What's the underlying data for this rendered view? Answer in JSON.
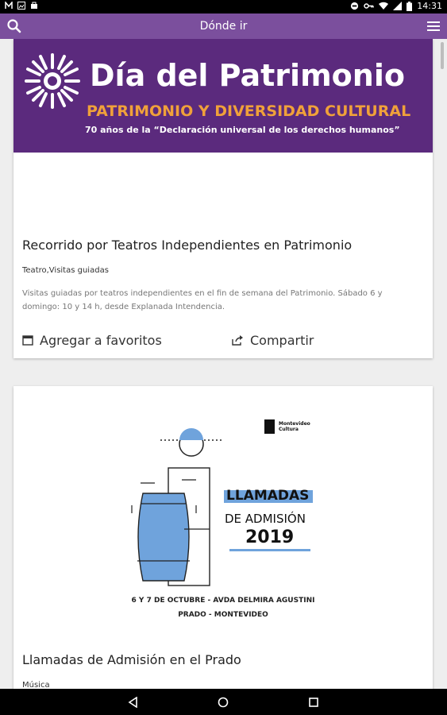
{
  "status": {
    "left_icons": [
      "m-icon",
      "image-icon",
      "bag-icon"
    ],
    "time": "14:31"
  },
  "appbar": {
    "title": "Dónde ir"
  },
  "cards": [
    {
      "banner": {
        "title": "Día del Patrimonio",
        "subtitle": "PATRIMONIO Y DIVERSIDAD CULTURAL",
        "caption": "70 años de la “Declaración universal de los derechos humanos”",
        "accent": "#5b2a7d",
        "orange": "#f0a13a"
      },
      "title": "Recorrido por Teatros Independientes en Patrimonio",
      "category": "Teatro,Visitas guiadas",
      "description": "Visitas guiadas por teatros independientes en el fin de semana del Patrimonio. Sábado 6 y domingo: 10 y 14 h, desde Explanada Intendencia.",
      "favorite_label": "Agregar a favoritos",
      "share_label": "Compartir"
    },
    {
      "poster": {
        "logo_line1": "Montevideo",
        "logo_line2": "Cultura",
        "heading1": "LLAMADAS",
        "heading2": "DE ADMISIÓN",
        "year": "2019",
        "date_line": "6 Y 7 DE OCTUBRE - AVDA DELMIRA AGUSTINI",
        "place_line": "PRADO - MONTEVIDEO",
        "blue": "#6fa3dc"
      },
      "title": "Llamadas de Admisión en el Prado",
      "category": "Música"
    }
  ]
}
